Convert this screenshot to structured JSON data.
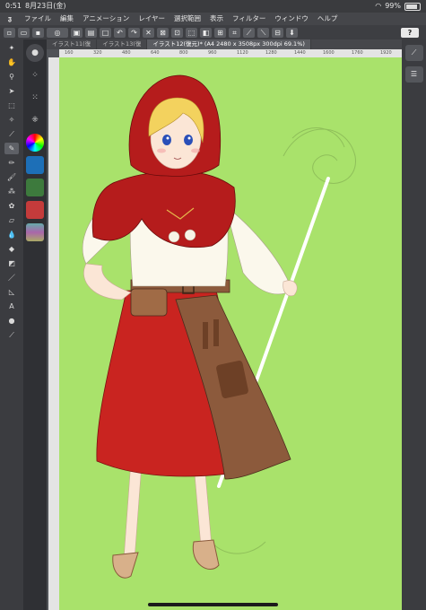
{
  "status": {
    "time": "0:51",
    "date": "8月23日(金)",
    "battery": "99%"
  },
  "menu": {
    "items": [
      "ファイル",
      "編集",
      "アニメーション",
      "レイヤー",
      "選択範囲",
      "表示",
      "フィルター",
      "ウィンドウ",
      "ヘルプ"
    ]
  },
  "commandbar": {
    "help_label": "?"
  },
  "tabs": [
    {
      "label": "イラスト11(復"
    },
    {
      "label": "イラスト13(復"
    },
    {
      "label": "イラスト12(復元)* (A4 2480 x 3508px 300dpi 69.1%)"
    }
  ],
  "ruler": {
    "top_ticks": [
      "160",
      "320",
      "480",
      "640",
      "800",
      "960",
      "1120",
      "1280",
      "1440",
      "1600",
      "1760",
      "1920"
    ]
  },
  "colors": {
    "canvas": "#a9e26b",
    "cloak_red": "#b51c1c",
    "dress_red": "#c92420",
    "skin": "#fbe6d6",
    "hair": "#f3d25e",
    "bag_brown": "#8c5a3c"
  },
  "left_tools": [
    "pointer-icon",
    "hand-icon",
    "zoom-icon",
    "operation-icon",
    "selection-icon",
    "auto-select-icon",
    "eyedropper-icon",
    "pen-icon",
    "pencil-icon",
    "brush-icon",
    "airbrush-icon",
    "decoration-icon",
    "eraser-icon",
    "blend-icon",
    "fill-icon",
    "gradient-icon",
    "figure-icon",
    "ruler-icon",
    "text-icon",
    "balloon-icon",
    "correct-line-icon"
  ]
}
